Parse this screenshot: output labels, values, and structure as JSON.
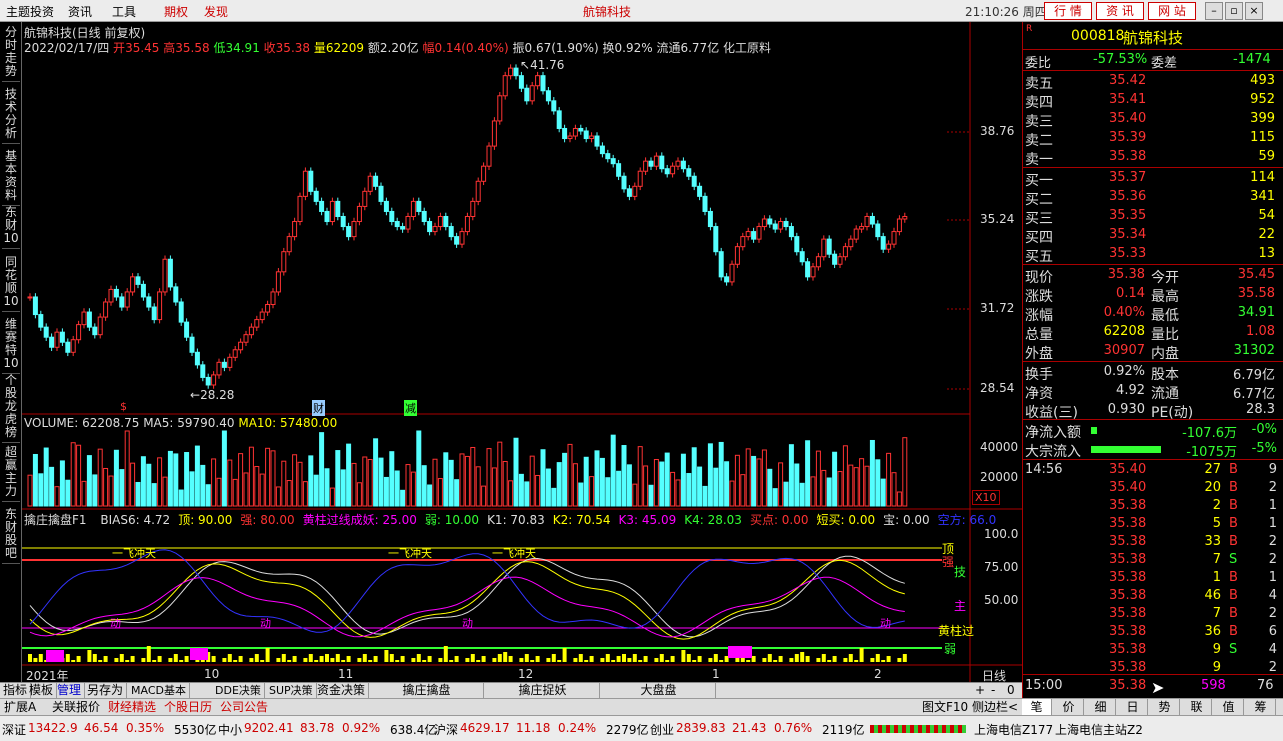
{
  "menu": {
    "items": [
      "主题投资",
      "资讯",
      "工具"
    ],
    "red_items": [
      "期权",
      "发现"
    ],
    "title": "航锦科技",
    "time": "21:10:26 周四",
    "tabs": [
      "行 情",
      "资 讯",
      "网 站"
    ]
  },
  "left_tabs": [
    "分时走势",
    "技术分析",
    "基本资料",
    "东财10",
    "同花顺10",
    "维赛特10",
    "个股龙虎榜",
    "超赢主力",
    "东财股吧"
  ],
  "chart": {
    "title": "航锦科技(日线 前复权)",
    "info_date": "2022/02/17/四",
    "info": [
      {
        "label": "开",
        "value": "35.45"
      },
      {
        "label": "高",
        "value": "35.58"
      },
      {
        "label": "低",
        "value": "34.91"
      },
      {
        "label": "收",
        "value": "35.38"
      },
      {
        "label": "量",
        "value": "62209"
      },
      {
        "label": "额",
        "value": "2.20亿"
      },
      {
        "label": "幅",
        "value": "0.14(0.40%)"
      }
    ],
    "info2": "振0.67(1.90%) 换0.92% 流通6.77亿 化工原料",
    "price_labels": [
      "38.76",
      "35.24",
      "31.72",
      "28.54"
    ],
    "high_mark": "41.76",
    "low_mark": "28.28",
    "markers": [
      "财",
      "减"
    ],
    "volume_label": "VOLUME: 62208.75",
    "ma5_label": "MA5: 59790.40",
    "ma10_label": "MA10: 57480.00",
    "volume_ticks": [
      "40000",
      "20000"
    ],
    "x10": "X10",
    "ind_title": "擒庄擒盘F1",
    "ind_values": [
      {
        "label": "BIAS6: 4.72",
        "color": "#ddd"
      },
      {
        "label": "顶: 90.00",
        "color": "#ff0"
      },
      {
        "label": "强: 80.00",
        "color": "#f33"
      },
      {
        "label": "黄柱过线成妖: 25.00",
        "color": "#f0f"
      },
      {
        "label": "弱: 10.00",
        "color": "#3f3"
      },
      {
        "label": "K1: 70.83",
        "color": "#ddd"
      },
      {
        "label": "K2: 70.54",
        "color": "#ff0"
      },
      {
        "label": "K3: 45.09",
        "color": "#f0f"
      },
      {
        "label": "K4: 28.03",
        "color": "#3f3"
      },
      {
        "label": "买点: 0.00",
        "color": "#f33"
      },
      {
        "label": "短买: 0.00",
        "color": "#ff0"
      },
      {
        "label": "宝: 0.00",
        "color": "#ddd"
      },
      {
        "label": "空方: 66.0",
        "color": "#33f"
      }
    ],
    "ind_ticks": [
      "100.0",
      "75.00",
      "50.00"
    ],
    "ind_right_labels": [
      "顶",
      "强",
      "技",
      "主",
      "黄柱过",
      "弱"
    ],
    "ind_text_marks": [
      "一飞冲天",
      "一飞冲天",
      "一飞冲天",
      "动",
      "动",
      "动",
      "动"
    ],
    "x_axis": [
      "2021年",
      "10",
      "11",
      "12",
      "1",
      "2"
    ],
    "period": "日线",
    "zoom": [
      "+",
      "-",
      "0"
    ]
  },
  "bottom_tabs": [
    "指标",
    "模板",
    "管理",
    "另存为",
    "MACD基本",
    "DDE决策",
    "SUP决策",
    "资金决策",
    "擒庄擒盘",
    "擒庄捉妖",
    "大盘盘"
  ],
  "bottom_tabs2": [
    "扩展A",
    "关联报价",
    "财经精选",
    "个股日历",
    "公司公告"
  ],
  "bottom_right": [
    "图文F10",
    "侧边栏<"
  ],
  "quote": {
    "code": "000818",
    "name": "航锦科技",
    "weibi": {
      "label": "委比",
      "value": "-57.53%",
      "label2": "委差",
      "value2": "-1474"
    },
    "asks": [
      {
        "label": "卖五",
        "price": "35.42",
        "vol": "493"
      },
      {
        "label": "卖四",
        "price": "35.41",
        "vol": "952"
      },
      {
        "label": "卖三",
        "price": "35.40",
        "vol": "399"
      },
      {
        "label": "卖二",
        "price": "35.39",
        "vol": "115"
      },
      {
        "label": "卖一",
        "price": "35.38",
        "vol": "59"
      }
    ],
    "bids": [
      {
        "label": "买一",
        "price": "35.37",
        "vol": "114"
      },
      {
        "label": "买二",
        "price": "35.36",
        "vol": "341"
      },
      {
        "label": "买三",
        "price": "35.35",
        "vol": "54"
      },
      {
        "label": "买四",
        "price": "35.34",
        "vol": "22"
      },
      {
        "label": "买五",
        "price": "35.33",
        "vol": "13"
      }
    ],
    "stats": [
      {
        "l1": "现价",
        "v1": "35.38",
        "c1": "red",
        "l2": "今开",
        "v2": "35.45",
        "c2": "red"
      },
      {
        "l1": "涨跌",
        "v1": "0.14",
        "c1": "red",
        "l2": "最高",
        "v2": "35.58",
        "c2": "red"
      },
      {
        "l1": "涨幅",
        "v1": "0.40%",
        "c1": "red",
        "l2": "最低",
        "v2": "34.91",
        "c2": "grn"
      },
      {
        "l1": "总量",
        "v1": "62208",
        "c1": "cy",
        "l2": "量比",
        "v2": "1.08",
        "c2": "red"
      },
      {
        "l1": "外盘",
        "v1": "30907",
        "c1": "red",
        "l2": "内盘",
        "v2": "31302",
        "c2": "grn"
      }
    ],
    "stats2": [
      {
        "l1": "换手",
        "v1": "0.92%",
        "l2": "股本",
        "v2": "6.79亿"
      },
      {
        "l1": "净资",
        "v1": "4.92",
        "l2": "流通",
        "v2": "6.77亿"
      },
      {
        "l1": "收益(三)",
        "v1": "0.930",
        "l2": "PE(动)",
        "v2": "28.3"
      }
    ],
    "flows": [
      {
        "label": "净流入额",
        "value": "-107.6万",
        "pct": "-0%"
      },
      {
        "label": "大宗流入",
        "value": "-1075万",
        "pct": "-5%"
      }
    ],
    "ticks": [
      {
        "time": "14:56",
        "price": "35.40",
        "vol": "27",
        "bs": "B",
        "n": "9"
      },
      {
        "time": "",
        "price": "35.40",
        "vol": "20",
        "bs": "B",
        "n": "2"
      },
      {
        "time": "",
        "price": "35.38",
        "vol": "2",
        "bs": "B",
        "n": "1"
      },
      {
        "time": "",
        "price": "35.38",
        "vol": "5",
        "bs": "B",
        "n": "1"
      },
      {
        "time": "",
        "price": "35.38",
        "vol": "33",
        "bs": "B",
        "n": "2"
      },
      {
        "time": "",
        "price": "35.38",
        "vol": "7",
        "bs": "S",
        "n": "2"
      },
      {
        "time": "",
        "price": "35.38",
        "vol": "1",
        "bs": "B",
        "n": "1"
      },
      {
        "time": "",
        "price": "35.38",
        "vol": "46",
        "bs": "B",
        "n": "4"
      },
      {
        "time": "",
        "price": "35.38",
        "vol": "7",
        "bs": "B",
        "n": "2"
      },
      {
        "time": "",
        "price": "35.38",
        "vol": "36",
        "bs": "B",
        "n": "6"
      },
      {
        "time": "",
        "price": "35.38",
        "vol": "9",
        "bs": "S",
        "n": "4"
      },
      {
        "time": "",
        "price": "35.38",
        "vol": "9",
        "bs": "",
        "n": "2"
      }
    ],
    "last_tick": {
      "time": "15:00",
      "price": "35.38",
      "vol": "598",
      "n": "76"
    },
    "bottom_tabs": [
      "笔",
      "价",
      "细",
      "日",
      "势",
      "联",
      "值",
      "筹"
    ]
  },
  "status": [
    {
      "label": "深证",
      "v": "13422.9",
      "c": "46.54",
      "p": "0.35%",
      "amt": "5530亿"
    },
    {
      "label": "中小",
      "v": "9202.41",
      "c": "83.78",
      "p": "0.92%",
      "amt": "638.4亿"
    },
    {
      "label": "沪深",
      "v": "4629.17",
      "c": "11.18",
      "p": "0.24%",
      "amt": "2279亿"
    },
    {
      "label": "创业",
      "v": "2839.83",
      "c": "21.43",
      "p": "0.76%",
      "amt": "2119亿"
    }
  ],
  "servers": [
    "上海电信Z177",
    "上海电信主站Z2"
  ],
  "colors": {
    "up": "#f33",
    "down": "#5ff",
    "bg": "#000",
    "accent": "#c00"
  }
}
